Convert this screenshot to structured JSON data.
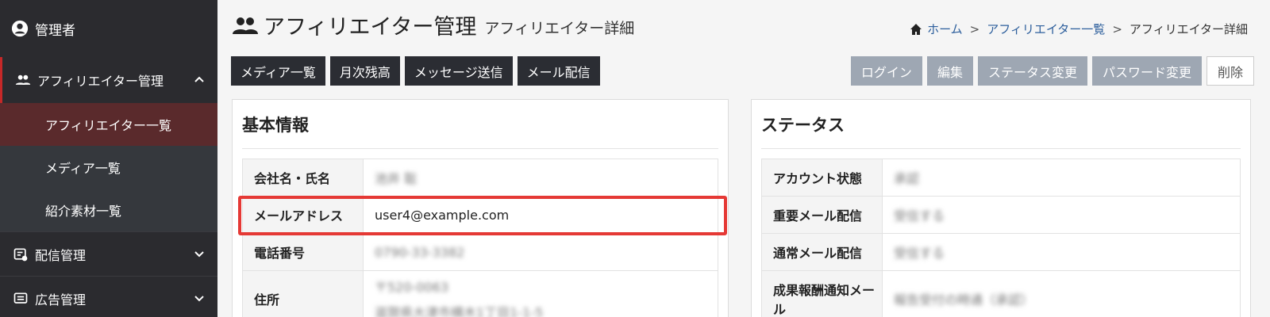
{
  "sidebar": {
    "user": "管理者",
    "group": "アフィリエイター管理",
    "subitems": [
      {
        "label": "アフィリエイター一覧"
      },
      {
        "label": "メディア一覧"
      },
      {
        "label": "紹介素材一覧"
      }
    ],
    "items": [
      {
        "label": "配信管理"
      },
      {
        "label": "広告管理"
      }
    ]
  },
  "header": {
    "title": "アフィリエイター管理",
    "subtitle": "アフィリエイター詳細",
    "breadcrumb": [
      "ホーム",
      "アフィリエイター一覧",
      "アフィリエイター詳細"
    ]
  },
  "toolbar_left": [
    "メディア一覧",
    "月次残高",
    "メッセージ送信",
    "メール配信"
  ],
  "toolbar_right": [
    "ログイン",
    "編集",
    "ステータス変更",
    "パスワード変更",
    "削除"
  ],
  "basic_info": {
    "title": "基本情報",
    "rows": [
      {
        "label": "会社名・氏名",
        "value": "池井 聡"
      },
      {
        "label": "メールアドレス",
        "value": "user4@example.com"
      },
      {
        "label": "電話番号",
        "value": "0790-33-3382"
      },
      {
        "label": "住所",
        "value": "〒520-0063",
        "value2": "滋賀県大津市横木1丁目1-1-5"
      }
    ]
  },
  "status": {
    "title": "ステータス",
    "rows": [
      {
        "label": "アカウント状態",
        "value": "承認"
      },
      {
        "label": "重要メール配信",
        "value": "受信する"
      },
      {
        "label": "通常メール配信",
        "value": "受信する"
      },
      {
        "label": "成果報酬通知メール",
        "value": "報告受付の時通（承認）"
      }
    ]
  }
}
